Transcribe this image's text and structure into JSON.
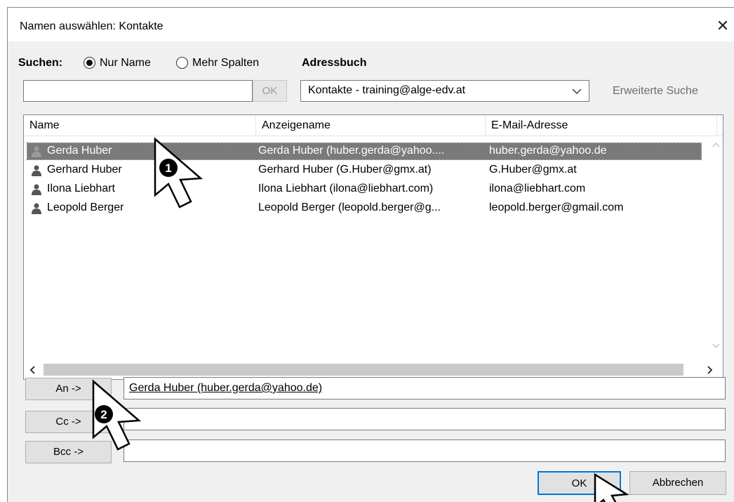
{
  "window": {
    "title": "Namen auswählen: Kontakte",
    "close_glyph": "✕"
  },
  "search": {
    "label": "Suchen:",
    "option_name": "Nur Name",
    "option_columns": "Mehr Spalten",
    "query_value": "",
    "ok_label": "OK"
  },
  "addressbook": {
    "label": "Adressbuch",
    "selected": "Kontakte - training@alge-edv.at",
    "advanced_search": "Erweiterte Suche"
  },
  "table": {
    "headers": [
      "Name",
      "Anzeigename",
      "E-Mail-Adresse"
    ],
    "rows": [
      {
        "name": "Gerda Huber",
        "display": "Gerda Huber (huber.gerda@yahoo....",
        "email": "huber.gerda@yahoo.de"
      },
      {
        "name": "Gerhard Huber",
        "display": "Gerhard Huber (G.Huber@gmx.at)",
        "email": "G.Huber@gmx.at"
      },
      {
        "name": "Ilona Liebhart",
        "display": "Ilona Liebhart (ilona@liebhart.com)",
        "email": "ilona@liebhart.com"
      },
      {
        "name": "Leopold Berger",
        "display": "Leopold Berger (leopold.berger@g...",
        "email": "leopold.berger@gmail.com"
      }
    ]
  },
  "recipients": {
    "to_label": "An ->",
    "to_value": "Gerda Huber (huber.gerda@yahoo.de)",
    "cc_label": "Cc ->",
    "cc_value": "",
    "bcc_label": "Bcc ->",
    "bcc_value": ""
  },
  "buttons": {
    "ok": "OK",
    "cancel": "Abbrechen"
  },
  "annotations": {
    "step1": "1",
    "step2": "2"
  },
  "colors": {
    "selection": "#7a7a7a",
    "dialog_bg": "#f0f0f0"
  }
}
